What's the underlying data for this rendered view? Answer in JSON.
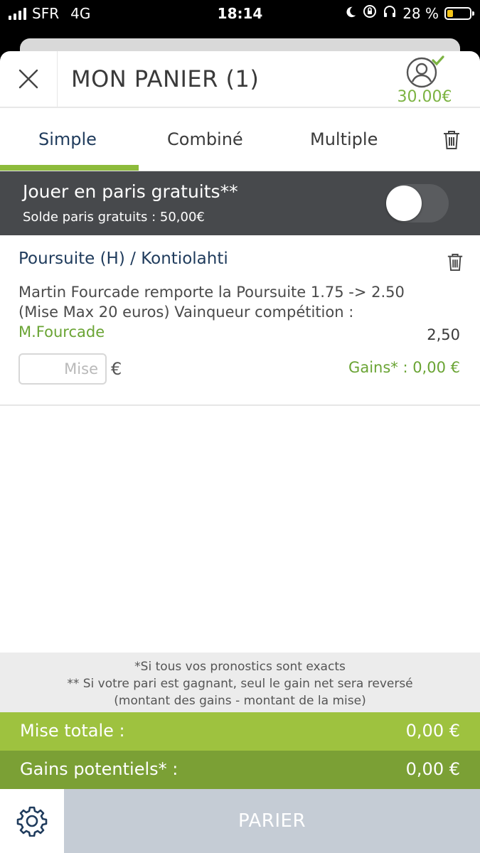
{
  "status_bar": {
    "carrier": "SFR",
    "network": "4G",
    "time": "18:14",
    "battery": "28 %",
    "icons": [
      "signal-icon",
      "moon-icon",
      "rotation-lock-icon",
      "headphones-icon",
      "battery-icon"
    ]
  },
  "header": {
    "title": "MON PANIER (1)",
    "balance": "30.00€",
    "icons": [
      "close-icon",
      "user-check-icon"
    ]
  },
  "tabs": {
    "items": [
      {
        "label": "Simple",
        "active": true
      },
      {
        "label": "Combiné",
        "active": false
      },
      {
        "label": "Multiple",
        "active": false
      }
    ],
    "trash_icon": "trash-icon"
  },
  "free_bets": {
    "title": "Jouer en paris gratuits**",
    "balance_text": "Solde paris gratuits : 50,00€",
    "toggle_on": false
  },
  "bet": {
    "event": "Poursuite (H) / Kontiolahti",
    "description": "Martin Fourcade remporte la Poursuite 1.75 -> 2.50 (Mise Max 20 euros) Vainqueur compétition : ",
    "selection": "M.Fourcade",
    "odds": "2,50",
    "stake_placeholder": "Mise",
    "currency": "€",
    "gains": "Gains* : 0,00 €"
  },
  "footnote": {
    "line1": "*Si tous vos pronostics sont exacts",
    "line2": "** Si votre pari est gagnant, seul le gain net sera reversé",
    "line3": "(montant des gains - montant de la mise)"
  },
  "totals": {
    "stake_label": "Mise totale  :",
    "stake_value": "0,00 €",
    "gains_label": "Gains potentiels* :",
    "gains_value": "0,00 €"
  },
  "actions": {
    "bet_label": "PARIER",
    "settings_icon": "gear-icon"
  },
  "colors": {
    "accent_green": "#9ec23f",
    "dark_green": "#7ba035",
    "navy": "#1f3b5c",
    "banner": "#47494c",
    "disabled_button": "#c5ccd5"
  }
}
